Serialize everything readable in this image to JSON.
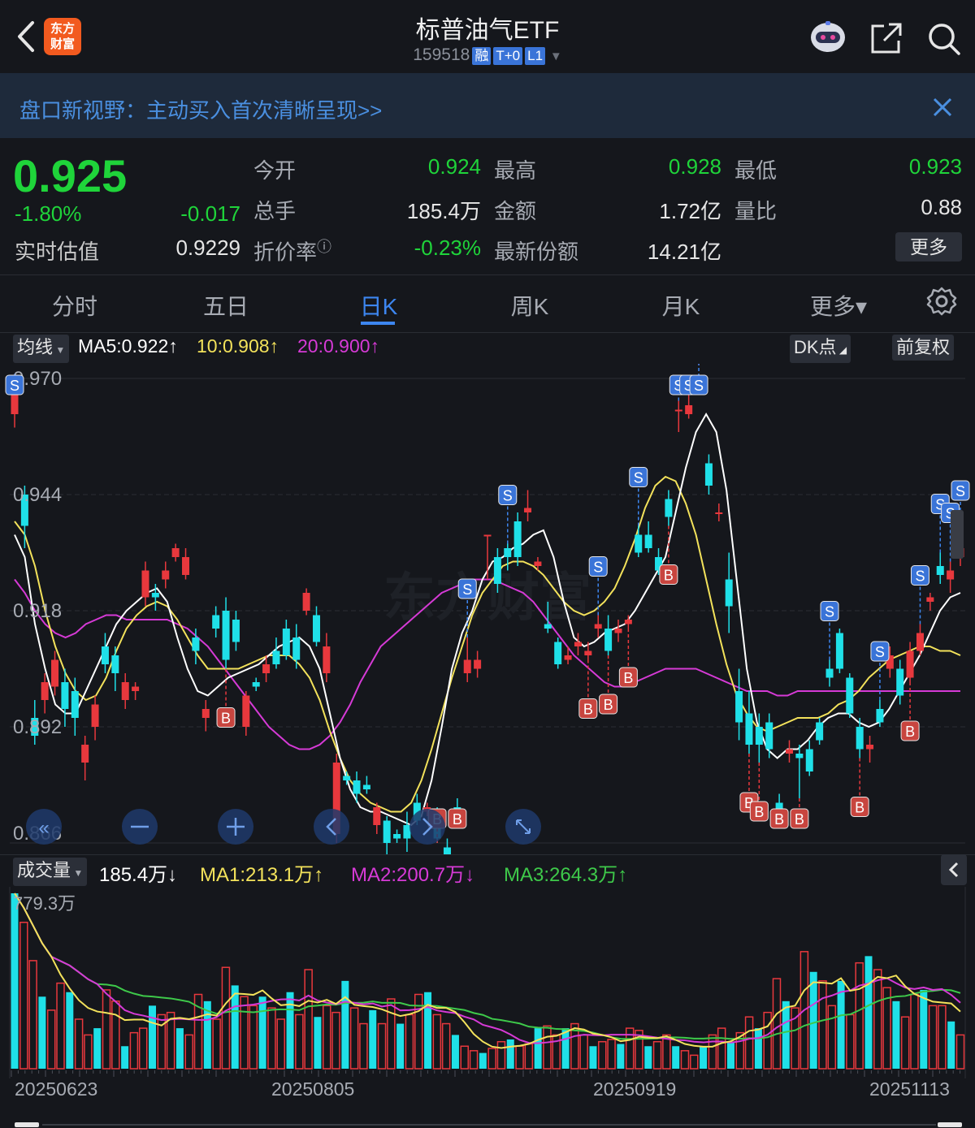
{
  "header": {
    "title": "标普油气ETF",
    "code": "159518",
    "tags": [
      "融",
      "T+0",
      "L1"
    ],
    "logo_line1": "东方",
    "logo_line2": "财富"
  },
  "banner": {
    "text": "盘口新视野：主动买入首次清晰呈现>>"
  },
  "quote": {
    "price": "0.925",
    "pct": "-1.80%",
    "change": "-0.017",
    "iopv_label": "实时估值",
    "iopv_value": "0.9229",
    "fields": [
      {
        "label": "今开",
        "value": "0.924",
        "color": "#1fd43a"
      },
      {
        "label": "最高",
        "value": "0.928",
        "color": "#1fd43a"
      },
      {
        "label": "最低",
        "value": "0.923",
        "color": "#1fd43a"
      },
      {
        "label": "总手",
        "value": "185.4万",
        "color": "#e6e6e6"
      },
      {
        "label": "金额",
        "value": "1.72亿",
        "color": "#e6e6e6"
      },
      {
        "label": "量比",
        "value": "0.88",
        "color": "#e6e6e6"
      },
      {
        "label": "折价率",
        "value": "-0.23%",
        "color": "#1fd43a"
      },
      {
        "label": "最新份额",
        "value": "14.21亿",
        "color": "#e6e6e6"
      }
    ],
    "more_label": "更多"
  },
  "tabs": [
    {
      "label": "分时",
      "active": false
    },
    {
      "label": "五日",
      "active": false
    },
    {
      "label": "日K",
      "active": true
    },
    {
      "label": "周K",
      "active": false
    },
    {
      "label": "月K",
      "active": false
    },
    {
      "label": "更多▾",
      "active": false
    }
  ],
  "ma_bar": {
    "selector": "均线",
    "ma5": "MA5:0.922↑",
    "ma10": "10:0.908↑",
    "ma20": "20:0.900↑",
    "dk": "DK点",
    "adjust": "前复权",
    "colors": {
      "ma5": "#ffffff",
      "ma10": "#f3e25b",
      "ma20": "#d63ad6"
    }
  },
  "price_axis": [
    "0.970",
    "0.944",
    "0.918",
    "0.892",
    "0.866"
  ],
  "volume_bar": {
    "selector": "成交量",
    "vol": "185.4万↓",
    "ma1": "MA1:213.1万↑",
    "ma2": "MA2:200.7万↓",
    "ma3": "MA3:264.3万↑",
    "colors": {
      "vol": "#ffffff",
      "ma1": "#f3e25b",
      "ma2": "#d63ad6",
      "ma3": "#3ec94a"
    }
  },
  "volume_axis_max": "779.3万",
  "dates": [
    "20250623",
    "20250805",
    "20250919",
    "20251113"
  ],
  "watermark": "东方财富",
  "chart_data": {
    "type": "candlestick",
    "ylim": [
      0.866,
      0.97
    ],
    "candles": [
      [
        0.962,
        0.97,
        0.959,
        0.971
      ],
      [
        0.944,
        0.937,
        0.932,
        0.946
      ],
      [
        0.894,
        0.89,
        0.888,
        0.898
      ],
      [
        0.898,
        0.902,
        0.895,
        0.904
      ],
      [
        0.901,
        0.907,
        0.899,
        0.909
      ],
      [
        0.902,
        0.896,
        0.892,
        0.905
      ],
      [
        0.9,
        0.894,
        0.89,
        0.903
      ],
      [
        0.884,
        0.888,
        0.88,
        0.89
      ],
      [
        0.892,
        0.897,
        0.889,
        0.899
      ],
      [
        0.91,
        0.906,
        0.904,
        0.913
      ],
      [
        0.908,
        0.904,
        0.9,
        0.91
      ],
      [
        0.898,
        0.902,
        0.896,
        0.904
      ],
      [
        0.9,
        0.901,
        0.898,
        0.902
      ],
      [
        0.921,
        0.927,
        0.919,
        0.929
      ],
      [
        0.922,
        0.921,
        0.918,
        0.924
      ],
      [
        0.925,
        0.927,
        0.923,
        0.929
      ],
      [
        0.93,
        0.932,
        0.929,
        0.933
      ],
      [
        0.926,
        0.93,
        0.925,
        0.932
      ],
      [
        0.912,
        0.909,
        0.906,
        0.914
      ],
      [
        0.894,
        0.896,
        0.891,
        0.898
      ],
      [
        0.917,
        0.914,
        0.912,
        0.919
      ],
      [
        0.918,
        0.907,
        0.905,
        0.921
      ],
      [
        0.916,
        0.911,
        0.909,
        0.918
      ],
      [
        0.892,
        0.899,
        0.89,
        0.9
      ],
      [
        0.902,
        0.901,
        0.9,
        0.903
      ],
      [
        0.904,
        0.906,
        0.902,
        0.908
      ],
      [
        0.909,
        0.906,
        0.905,
        0.912
      ],
      [
        0.914,
        0.908,
        0.907,
        0.916
      ],
      [
        0.912,
        0.907,
        0.905,
        0.915
      ],
      [
        0.918,
        0.922,
        0.917,
        0.923
      ],
      [
        0.917,
        0.911,
        0.91,
        0.919
      ],
      [
        0.904,
        0.91,
        0.902,
        0.913
      ],
      [
        0.868,
        0.884,
        0.866,
        0.886
      ],
      [
        0.881,
        0.88,
        0.879,
        0.882
      ],
      [
        0.88,
        0.877,
        0.875,
        0.882
      ],
      [
        0.879,
        0.878,
        0.877,
        0.881
      ],
      [
        0.87,
        0.874,
        0.868,
        0.875
      ],
      [
        0.871,
        0.866,
        0.862,
        0.872
      ],
      [
        0.868,
        0.867,
        0.866,
        0.869
      ],
      [
        0.87,
        0.867,
        0.864,
        0.873
      ],
      [
        0.875,
        0.871,
        0.87,
        0.877
      ],
      [
        0.873,
        0.874,
        0.872,
        0.875
      ],
      [
        0.872,
        0.867,
        0.866,
        0.874
      ],
      [
        0.865,
        0.863,
        0.861,
        0.867
      ],
      [
        0.874,
        0.871,
        0.87,
        0.876
      ],
      [
        0.904,
        0.907,
        0.902,
        0.912
      ],
      [
        0.905,
        0.907,
        0.903,
        0.909
      ],
      [
        0.935,
        0.935,
        0.925,
        0.935
      ],
      [
        0.93,
        0.924,
        0.922,
        0.932
      ],
      [
        0.932,
        0.93,
        0.927,
        0.933
      ],
      [
        0.938,
        0.93,
        0.928,
        0.94
      ],
      [
        0.94,
        0.941,
        0.938,
        0.945
      ],
      [
        0.928,
        0.929,
        0.927,
        0.93
      ],
      [
        0.915,
        0.914,
        0.913,
        0.92
      ],
      [
        0.911,
        0.906,
        0.905,
        0.912
      ],
      [
        0.907,
        0.908,
        0.906,
        0.91
      ],
      [
        0.91,
        0.911,
        0.908,
        0.913
      ],
      [
        0.908,
        0.909,
        0.907,
        0.911
      ],
      [
        0.914,
        0.915,
        0.912,
        0.917
      ],
      [
        0.914,
        0.909,
        0.908,
        0.917
      ],
      [
        0.913,
        0.914,
        0.911,
        0.916
      ],
      [
        0.915,
        0.916,
        0.914,
        0.917
      ],
      [
        0.935,
        0.931,
        0.93,
        0.937
      ],
      [
        0.935,
        0.932,
        0.931,
        0.938
      ],
      [
        0.93,
        0.927,
        0.926,
        0.932
      ],
      [
        0.943,
        0.939,
        0.937,
        0.945
      ],
      [
        0.963,
        0.963,
        0.958,
        0.965
      ],
      [
        0.962,
        0.964,
        0.961,
        0.967
      ],
      [
        0.975,
        0.977,
        0.973,
        0.98
      ],
      [
        0.951,
        0.946,
        0.944,
        0.953
      ],
      [
        0.94,
        0.94,
        0.938,
        0.942
      ],
      [
        0.925,
        0.919,
        0.913,
        0.931
      ],
      [
        0.9,
        0.893,
        0.889,
        0.905
      ],
      [
        0.895,
        0.888,
        0.886,
        0.9
      ],
      [
        0.892,
        0.888,
        0.884,
        0.895
      ],
      [
        0.893,
        0.887,
        0.885,
        0.895
      ],
      [
        0.875,
        0.871,
        0.87,
        0.877
      ],
      [
        0.886,
        0.887,
        0.884,
        0.889
      ],
      [
        0.886,
        0.885,
        0.876,
        0.888
      ],
      [
        0.887,
        0.882,
        0.881,
        0.889
      ],
      [
        0.893,
        0.889,
        0.888,
        0.894
      ],
      [
        0.905,
        0.903,
        0.901,
        0.907
      ],
      [
        0.913,
        0.905,
        0.904,
        0.914
      ],
      [
        0.903,
        0.895,
        0.894,
        0.904
      ],
      [
        0.892,
        0.887,
        0.885,
        0.894
      ],
      [
        0.887,
        0.888,
        0.884,
        0.89
      ],
      [
        0.896,
        0.893,
        0.892,
        0.898
      ],
      [
        0.905,
        0.908,
        0.903,
        0.91
      ],
      [
        0.905,
        0.899,
        0.897,
        0.907
      ],
      [
        0.903,
        0.909,
        0.902,
        0.911
      ],
      [
        0.909,
        0.913,
        0.908,
        0.915
      ],
      [
        0.92,
        0.921,
        0.918,
        0.922
      ],
      [
        0.928,
        0.926,
        0.924,
        0.931
      ],
      [
        0.925,
        0.927,
        0.922,
        0.929
      ],
      [
        0.93,
        0.932,
        0.928,
        0.934
      ]
    ],
    "ma5": [
      0.935,
      0.93,
      0.915,
      0.905,
      0.897,
      0.895,
      0.895,
      0.9,
      0.905,
      0.91,
      0.915,
      0.918,
      0.92,
      0.922,
      0.923,
      0.92,
      0.912,
      0.905,
      0.9,
      0.899,
      0.901,
      0.903,
      0.904,
      0.905,
      0.906,
      0.908,
      0.91,
      0.911,
      0.912,
      0.91,
      0.905,
      0.895,
      0.885,
      0.878,
      0.874,
      0.873,
      0.873,
      0.872,
      0.871,
      0.87,
      0.872,
      0.88,
      0.892,
      0.905,
      0.913,
      0.918,
      0.925,
      0.929,
      0.93,
      0.932,
      0.933,
      0.935,
      0.936,
      0.93,
      0.92,
      0.912,
      0.91,
      0.911,
      0.913,
      0.914,
      0.915,
      0.918,
      0.922,
      0.926,
      0.93,
      0.94,
      0.95,
      0.958,
      0.962,
      0.958,
      0.945,
      0.925,
      0.905,
      0.893,
      0.887,
      0.885,
      0.887,
      0.887,
      0.889,
      0.892,
      0.894,
      0.895,
      0.895,
      0.893,
      0.892,
      0.893,
      0.896,
      0.9,
      0.904,
      0.908,
      0.913,
      0.918,
      0.921,
      0.922
    ],
    "ma10": [
      0.938,
      0.935,
      0.928,
      0.918,
      0.91,
      0.904,
      0.9,
      0.898,
      0.899,
      0.903,
      0.909,
      0.914,
      0.917,
      0.919,
      0.92,
      0.919,
      0.916,
      0.912,
      0.908,
      0.905,
      0.905,
      0.905,
      0.905,
      0.906,
      0.907,
      0.908,
      0.908,
      0.908,
      0.906,
      0.903,
      0.898,
      0.891,
      0.885,
      0.88,
      0.877,
      0.875,
      0.874,
      0.873,
      0.873,
      0.875,
      0.88,
      0.887,
      0.895,
      0.903,
      0.91,
      0.917,
      0.922,
      0.925,
      0.928,
      0.929,
      0.929,
      0.928,
      0.926,
      0.923,
      0.92,
      0.918,
      0.917,
      0.918,
      0.92,
      0.923,
      0.928,
      0.934,
      0.941,
      0.946,
      0.948,
      0.947,
      0.942,
      0.935,
      0.925,
      0.915,
      0.906,
      0.899,
      0.895,
      0.892,
      0.891,
      0.892,
      0.893,
      0.894,
      0.894,
      0.894,
      0.895,
      0.897,
      0.898,
      0.9,
      0.903,
      0.905,
      0.907,
      0.908,
      0.909,
      0.91,
      0.91,
      0.909,
      0.909,
      0.908
    ],
    "ma20": [
      0.925,
      0.922,
      0.918,
      0.915,
      0.913,
      0.912,
      0.913,
      0.915,
      0.916,
      0.917,
      0.917,
      0.916,
      0.916,
      0.916,
      0.916,
      0.916,
      0.915,
      0.914,
      0.912,
      0.91,
      0.907,
      0.904,
      0.901,
      0.898,
      0.895,
      0.892,
      0.89,
      0.888,
      0.887,
      0.887,
      0.888,
      0.89,
      0.893,
      0.897,
      0.902,
      0.906,
      0.91,
      0.912,
      0.914,
      0.916,
      0.918,
      0.92,
      0.922,
      0.923,
      0.924,
      0.925,
      0.925,
      0.925,
      0.924,
      0.923,
      0.922,
      0.92,
      0.917,
      0.914,
      0.911,
      0.908,
      0.906,
      0.904,
      0.902,
      0.901,
      0.901,
      0.902,
      0.903,
      0.904,
      0.905,
      0.905,
      0.905,
      0.905,
      0.904,
      0.903,
      0.902,
      0.901,
      0.9,
      0.9,
      0.9,
      0.899,
      0.899,
      0.9,
      0.9,
      0.9,
      0.9,
      0.9,
      0.9,
      0.9,
      0.9,
      0.9,
      0.9,
      0.9,
      0.9,
      0.9,
      0.9,
      0.9,
      0.9,
      0.9
    ],
    "volume": [
      7.79,
      6.5,
      4.8,
      3.2,
      2.6,
      3.8,
      3.4,
      2.2,
      1.5,
      1.8,
      3.5,
      3.0,
      1.0,
      1.6,
      1.8,
      2.8,
      2.4,
      2.5,
      1.8,
      1.5,
      3.3,
      3.0,
      2.2,
      4.5,
      3.7,
      3.2,
      2.8,
      3.2,
      2.7,
      2.2,
      3.4,
      2.4,
      4.4,
      2.3,
      2.8,
      2.5,
      3.9,
      2.7,
      2.0,
      2.6,
      2.0,
      3.1,
      2.0,
      2.4,
      3.3,
      3.4,
      2.4,
      2.0,
      1.5,
      1.0,
      0.8,
      0.7,
      0.9,
      1.2,
      1.3,
      1.0,
      1.1,
      1.8,
      1.9,
      1.5,
      1.8,
      2.0,
      1.5,
      1.0,
      1.2,
      1.3,
      1.1,
      1.8,
      1.7,
      1.0,
      1.2,
      1.5,
      1.0,
      0.8,
      0.6,
      1.0,
      1.5,
      1.8,
      1.2,
      1.6,
      2.3,
      1.8,
      2.5,
      4.0,
      3.0,
      2.7,
      5.2,
      4.3,
      3.9,
      2.8,
      3.9,
      2.4,
      4.7,
      5.0,
      4.4,
      3.6,
      3.0,
      2.3,
      3.3,
      3.5,
      2.8,
      2.8,
      2.1,
      1.5
    ]
  }
}
